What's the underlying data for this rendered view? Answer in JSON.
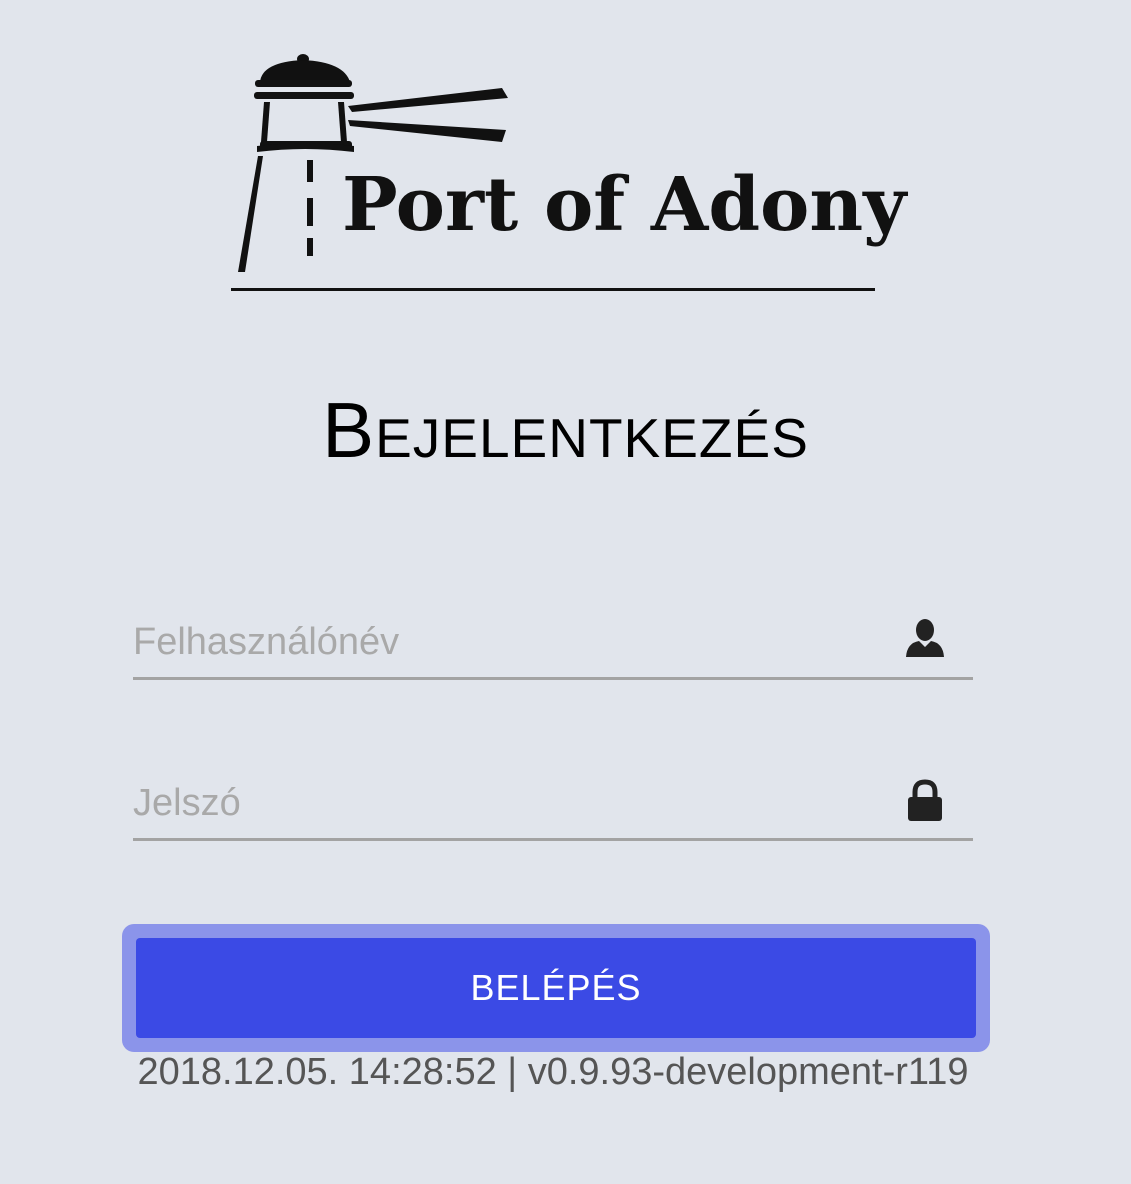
{
  "logo": {
    "text": "Port of Adony"
  },
  "login": {
    "title": "Bejelentkezés",
    "username_placeholder": "Felhasználónév",
    "username_value": "",
    "password_placeholder": "Jelszó",
    "password_value": "",
    "submit_label": "BELÉPÉS"
  },
  "icons": {
    "username": "user-icon",
    "password": "lock-icon"
  },
  "colors": {
    "background": "#e1e5ec",
    "button": "#3b4ae5",
    "button_focus_ring": "#8b94ea",
    "field_underline": "#a3a3a3"
  },
  "footer": {
    "version_info": "2018.12.05. 14:28:52 | v0.9.93-development-r119"
  }
}
